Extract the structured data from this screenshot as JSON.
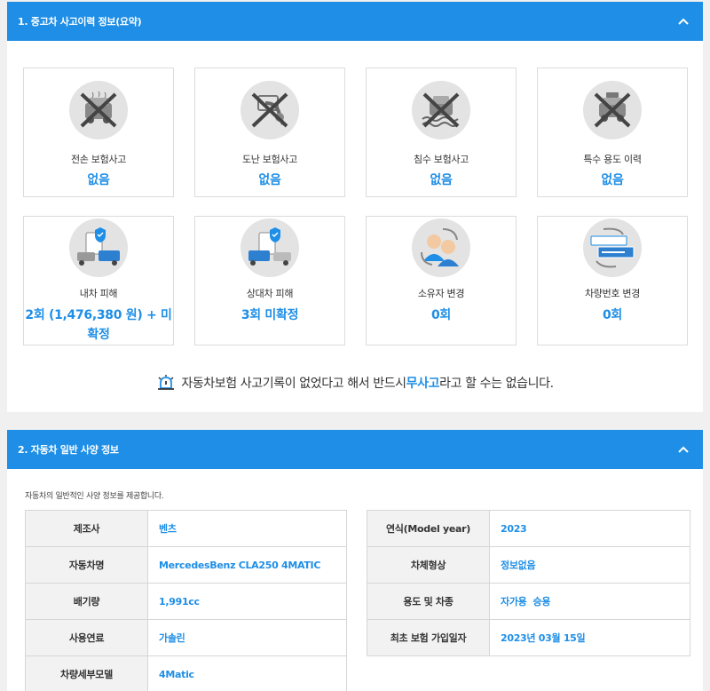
{
  "section1": {
    "title": "1. 중고차 사고이력 정보(요약)",
    "cards": [
      {
        "label": "전손 보험사고",
        "value": "없음",
        "icon": "car-crash-crossed-icon"
      },
      {
        "label": "도난 보험사고",
        "value": "없음",
        "icon": "theft-crossed-icon"
      },
      {
        "label": "침수 보험사고",
        "value": "없음",
        "icon": "flood-crossed-icon"
      },
      {
        "label": "특수 용도 이력",
        "value": "없음",
        "icon": "taxi-crossed-icon"
      },
      {
        "label": "내차 피해",
        "value": "2회 (1,476,380 원) + 미확정",
        "icon": "my-car-damage-icon"
      },
      {
        "label": "상대차 피해",
        "value": "3회 미확정",
        "icon": "other-car-damage-icon"
      },
      {
        "label": "소유자 변경",
        "value": "0회",
        "icon": "owner-change-icon"
      },
      {
        "label": "차량번호 변경",
        "value": "0회",
        "icon": "plate-change-icon"
      }
    ],
    "notice": {
      "before": "자동차보험 사고기록이 없었다고 해서 반드시 ",
      "highlight": "무사고",
      "after": "라고 할 수는 없습니다."
    }
  },
  "section2": {
    "title": "2. 자동차 일반 사양 정보",
    "description": "자동차의 일반적인 사양 정보를 제공합니다.",
    "left_rows": [
      {
        "key": "제조사",
        "value": "벤츠"
      },
      {
        "key": "자동차명",
        "value": "MercedesBenz CLA250 4MATIC"
      },
      {
        "key": "배기량",
        "value": "1,991cc"
      },
      {
        "key": "사용연료",
        "value": "가솔린"
      },
      {
        "key": "차량세부모델",
        "value": "4Matic"
      }
    ],
    "right_rows": [
      {
        "key": "연식(Model year)",
        "value": "2023"
      },
      {
        "key": "차체형상",
        "value": "정보없음"
      },
      {
        "key": "용도 및 차종",
        "value": "자가용  승용"
      },
      {
        "key": "최초 보험 가입일자",
        "value": "2023년 03월 15일"
      }
    ]
  },
  "colors": {
    "accent": "#1e8ee6",
    "card_border": "#dcdcdc",
    "icon_bg": "#e3e3e3"
  }
}
